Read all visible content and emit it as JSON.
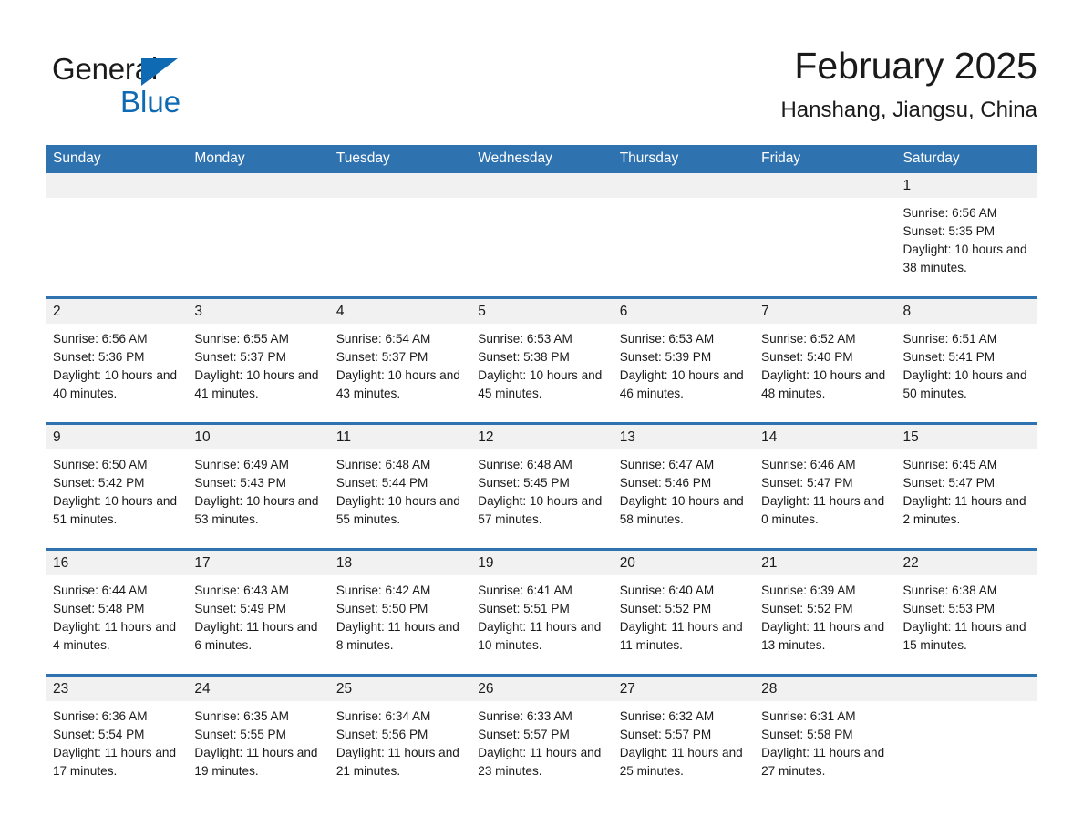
{
  "brand": {
    "name_part1": "General",
    "name_part2": "Blue",
    "triangle_color": "#0f6ab4",
    "text_color": "#1a1a1a"
  },
  "header": {
    "title": "February 2025",
    "subtitle": "Hanshang, Jiangsu, China"
  },
  "colors": {
    "header_blue": "#2e72b0",
    "daynum_band": "#f1f1f1",
    "text": "#1a1a1a"
  },
  "calendar": {
    "weekday_headers": [
      "Sunday",
      "Monday",
      "Tuesday",
      "Wednesday",
      "Thursday",
      "Friday",
      "Saturday"
    ],
    "weeks": [
      [
        {
          "day": "",
          "empty": true
        },
        {
          "day": "",
          "empty": true
        },
        {
          "day": "",
          "empty": true
        },
        {
          "day": "",
          "empty": true
        },
        {
          "day": "",
          "empty": true
        },
        {
          "day": "",
          "empty": true
        },
        {
          "day": "1",
          "sunrise": "Sunrise: 6:56 AM",
          "sunset": "Sunset: 5:35 PM",
          "daylight": "Daylight: 10 hours and 38 minutes."
        }
      ],
      [
        {
          "day": "2",
          "sunrise": "Sunrise: 6:56 AM",
          "sunset": "Sunset: 5:36 PM",
          "daylight": "Daylight: 10 hours and 40 minutes."
        },
        {
          "day": "3",
          "sunrise": "Sunrise: 6:55 AM",
          "sunset": "Sunset: 5:37 PM",
          "daylight": "Daylight: 10 hours and 41 minutes."
        },
        {
          "day": "4",
          "sunrise": "Sunrise: 6:54 AM",
          "sunset": "Sunset: 5:37 PM",
          "daylight": "Daylight: 10 hours and 43 minutes."
        },
        {
          "day": "5",
          "sunrise": "Sunrise: 6:53 AM",
          "sunset": "Sunset: 5:38 PM",
          "daylight": "Daylight: 10 hours and 45 minutes."
        },
        {
          "day": "6",
          "sunrise": "Sunrise: 6:53 AM",
          "sunset": "Sunset: 5:39 PM",
          "daylight": "Daylight: 10 hours and 46 minutes."
        },
        {
          "day": "7",
          "sunrise": "Sunrise: 6:52 AM",
          "sunset": "Sunset: 5:40 PM",
          "daylight": "Daylight: 10 hours and 48 minutes."
        },
        {
          "day": "8",
          "sunrise": "Sunrise: 6:51 AM",
          "sunset": "Sunset: 5:41 PM",
          "daylight": "Daylight: 10 hours and 50 minutes."
        }
      ],
      [
        {
          "day": "9",
          "sunrise": "Sunrise: 6:50 AM",
          "sunset": "Sunset: 5:42 PM",
          "daylight": "Daylight: 10 hours and 51 minutes."
        },
        {
          "day": "10",
          "sunrise": "Sunrise: 6:49 AM",
          "sunset": "Sunset: 5:43 PM",
          "daylight": "Daylight: 10 hours and 53 minutes."
        },
        {
          "day": "11",
          "sunrise": "Sunrise: 6:48 AM",
          "sunset": "Sunset: 5:44 PM",
          "daylight": "Daylight: 10 hours and 55 minutes."
        },
        {
          "day": "12",
          "sunrise": "Sunrise: 6:48 AM",
          "sunset": "Sunset: 5:45 PM",
          "daylight": "Daylight: 10 hours and 57 minutes."
        },
        {
          "day": "13",
          "sunrise": "Sunrise: 6:47 AM",
          "sunset": "Sunset: 5:46 PM",
          "daylight": "Daylight: 10 hours and 58 minutes."
        },
        {
          "day": "14",
          "sunrise": "Sunrise: 6:46 AM",
          "sunset": "Sunset: 5:47 PM",
          "daylight": "Daylight: 11 hours and 0 minutes."
        },
        {
          "day": "15",
          "sunrise": "Sunrise: 6:45 AM",
          "sunset": "Sunset: 5:47 PM",
          "daylight": "Daylight: 11 hours and 2 minutes."
        }
      ],
      [
        {
          "day": "16",
          "sunrise": "Sunrise: 6:44 AM",
          "sunset": "Sunset: 5:48 PM",
          "daylight": "Daylight: 11 hours and 4 minutes."
        },
        {
          "day": "17",
          "sunrise": "Sunrise: 6:43 AM",
          "sunset": "Sunset: 5:49 PM",
          "daylight": "Daylight: 11 hours and 6 minutes."
        },
        {
          "day": "18",
          "sunrise": "Sunrise: 6:42 AM",
          "sunset": "Sunset: 5:50 PM",
          "daylight": "Daylight: 11 hours and 8 minutes."
        },
        {
          "day": "19",
          "sunrise": "Sunrise: 6:41 AM",
          "sunset": "Sunset: 5:51 PM",
          "daylight": "Daylight: 11 hours and 10 minutes."
        },
        {
          "day": "20",
          "sunrise": "Sunrise: 6:40 AM",
          "sunset": "Sunset: 5:52 PM",
          "daylight": "Daylight: 11 hours and 11 minutes."
        },
        {
          "day": "21",
          "sunrise": "Sunrise: 6:39 AM",
          "sunset": "Sunset: 5:52 PM",
          "daylight": "Daylight: 11 hours and 13 minutes."
        },
        {
          "day": "22",
          "sunrise": "Sunrise: 6:38 AM",
          "sunset": "Sunset: 5:53 PM",
          "daylight": "Daylight: 11 hours and 15 minutes."
        }
      ],
      [
        {
          "day": "23",
          "sunrise": "Sunrise: 6:36 AM",
          "sunset": "Sunset: 5:54 PM",
          "daylight": "Daylight: 11 hours and 17 minutes."
        },
        {
          "day": "24",
          "sunrise": "Sunrise: 6:35 AM",
          "sunset": "Sunset: 5:55 PM",
          "daylight": "Daylight: 11 hours and 19 minutes."
        },
        {
          "day": "25",
          "sunrise": "Sunrise: 6:34 AM",
          "sunset": "Sunset: 5:56 PM",
          "daylight": "Daylight: 11 hours and 21 minutes."
        },
        {
          "day": "26",
          "sunrise": "Sunrise: 6:33 AM",
          "sunset": "Sunset: 5:57 PM",
          "daylight": "Daylight: 11 hours and 23 minutes."
        },
        {
          "day": "27",
          "sunrise": "Sunrise: 6:32 AM",
          "sunset": "Sunset: 5:57 PM",
          "daylight": "Daylight: 11 hours and 25 minutes."
        },
        {
          "day": "28",
          "sunrise": "Sunrise: 6:31 AM",
          "sunset": "Sunset: 5:58 PM",
          "daylight": "Daylight: 11 hours and 27 minutes."
        },
        {
          "day": "",
          "empty": true
        }
      ]
    ]
  }
}
